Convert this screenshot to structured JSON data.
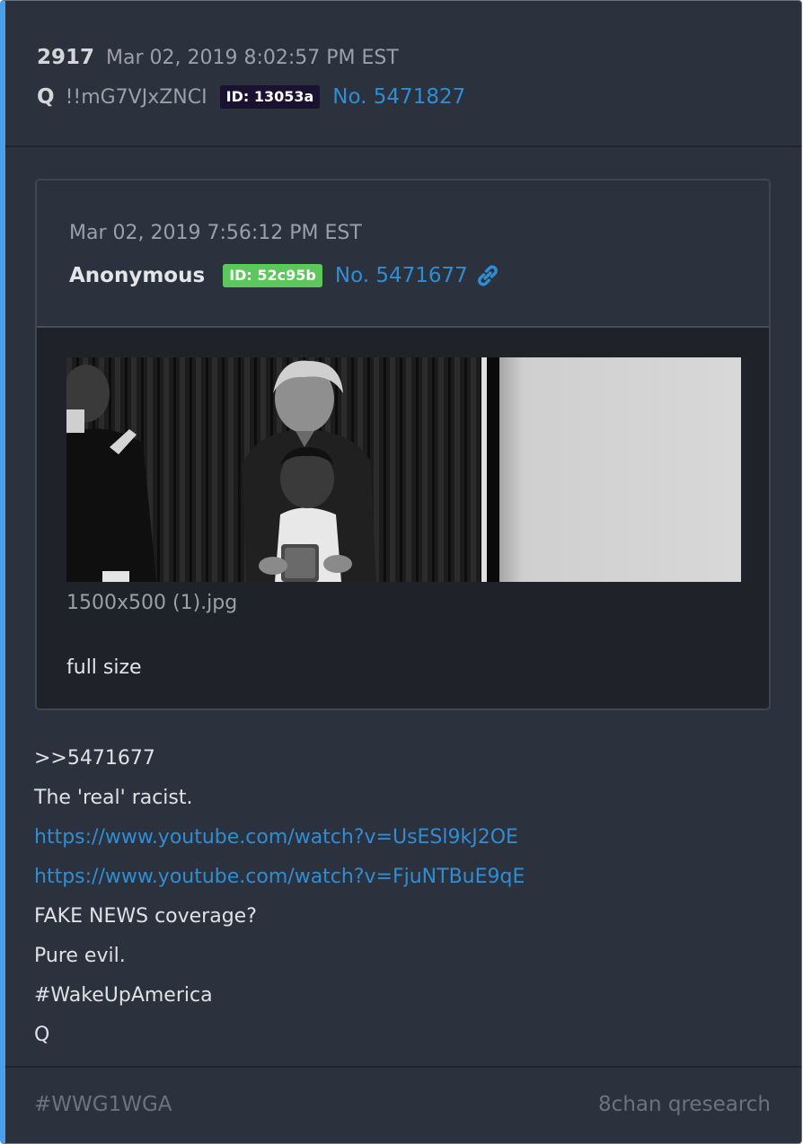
{
  "post": {
    "number": "2917",
    "timestamp": "Mar 02, 2019 8:02:57 PM EST",
    "author": "Q",
    "tripcode": "!!mG7VJxZNCI",
    "id_badge": "ID: 13053a",
    "post_link": "No. 5471827"
  },
  "quoted_post": {
    "timestamp": "Mar 02, 2019 7:56:12 PM EST",
    "author": "Anonymous",
    "id_badge": "ID: 52c95b",
    "post_link": "No. 5471677",
    "link_icon": "chain-link-icon",
    "image": {
      "filename": "1500x500 (1).jpg",
      "full_size_label": "full size"
    }
  },
  "body": {
    "lines": [
      ">>5471677",
      "The 'real' racist.",
      "https://www.youtube.com/watch?v=UsESl9kJ2OE",
      "https://www.youtube.com/watch?v=FjuNTBuE9qE",
      "FAKE NEWS coverage?",
      "Pure evil.",
      "#WakeUpAmerica",
      "Q"
    ]
  },
  "footer": {
    "tag": "#WWG1WGA",
    "source": "8chan qresearch"
  },
  "colors": {
    "card_bg": "#2c323d",
    "accent_left": "#4a9fe8",
    "link": "#2f8dd4",
    "id_q_bg": "#1a1230",
    "id_anon_bg": "#5cc85b"
  }
}
